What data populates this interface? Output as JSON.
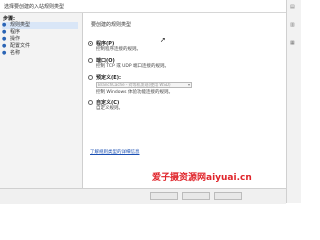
{
  "window": {
    "title": "选择要创建的入站规则类型"
  },
  "sidebar": {
    "header": "步骤:",
    "items": [
      {
        "label": "规则类型",
        "active": true
      },
      {
        "label": "程序",
        "active": false
      },
      {
        "label": "操作",
        "active": false
      },
      {
        "label": "配置文件",
        "active": false
      },
      {
        "label": "名称",
        "active": false
      }
    ]
  },
  "main": {
    "prompt": "要创建的规则类型",
    "options": [
      {
        "label": "程序(P)",
        "desc": "控制程序连接的规则。",
        "checked": true
      },
      {
        "label": "端口(O)",
        "desc": "控制 TCP 或 UDP 端口连接的规则。",
        "checked": false
      },
      {
        "label": "预定义(E):",
        "desc": "控制 Windows 体验功能连接的规则。",
        "checked": false,
        "combo_value": "BranchCache - 对等机发现(使用 WSD)"
      },
      {
        "label": "自定义(C)",
        "desc": "自定义规则。",
        "checked": false
      }
    ],
    "learn_link": "了解规则类型的详细信息"
  },
  "watermark": "爱子摄资源网aiyuai.cn",
  "colors": {
    "sidebar_active": "#d9e6f7",
    "link": "#1a4fb3",
    "watermark": "#e0242a"
  },
  "icons": {
    "cursor": "mouse-pointer-icon",
    "combo_arrow": "chevron-down-icon",
    "bullet": "step-bullet-icon"
  }
}
